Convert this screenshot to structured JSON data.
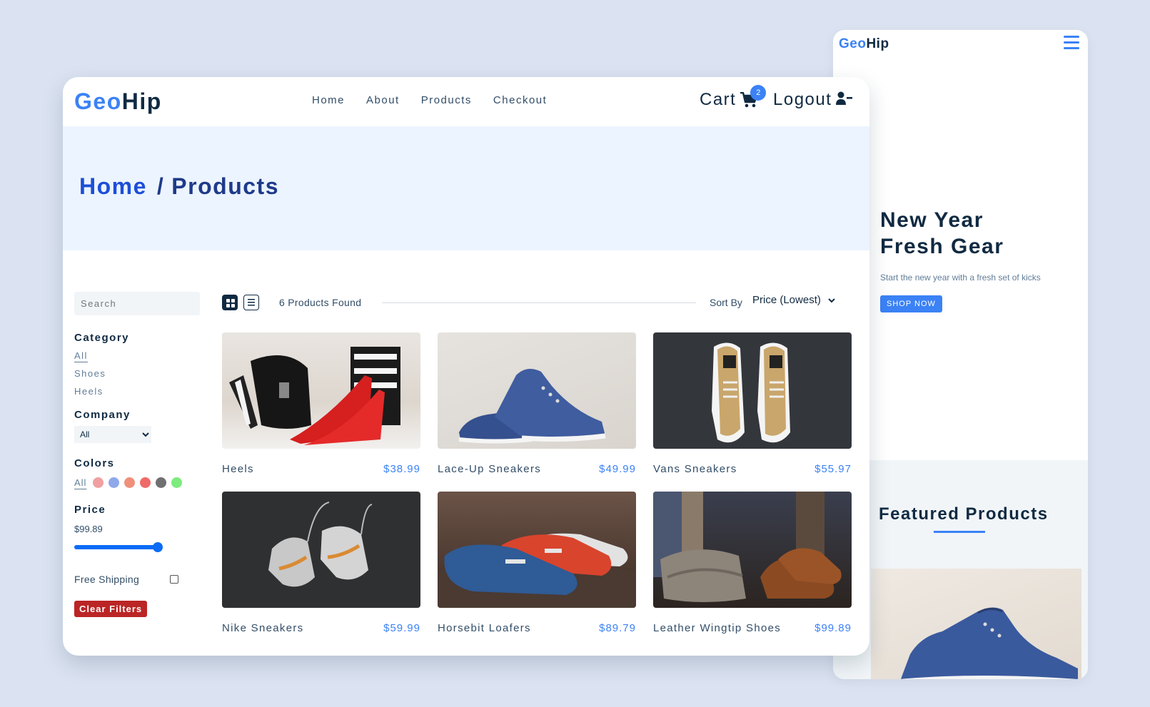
{
  "colors": {
    "accent": "#3b82f6",
    "dark": "#102a42",
    "hero_bg": "#ecf4ff",
    "clear_button": "#bb2525"
  },
  "brand": {
    "geo": "Geo",
    "hip": "Hip"
  },
  "nav": {
    "links": [
      "Home",
      "About",
      "Products",
      "Checkout"
    ],
    "cart_label": "Cart",
    "cart_count": "2",
    "logout_label": "Logout",
    "cart_icon": "cart-icon",
    "user_icon": "user-minus-icon"
  },
  "breadcrumb": {
    "home": "Home",
    "separator": "/",
    "current": "Products"
  },
  "filters": {
    "search_placeholder": "Search",
    "category_title": "Category",
    "categories": [
      "All",
      "Shoes",
      "Heels"
    ],
    "company_title": "Company",
    "company_selected": "All",
    "colors_title": "Colors",
    "colors_all": "All",
    "swatches": [
      "#f0a0a0",
      "#8fa8ea",
      "#f0907a",
      "#f06a6a",
      "#707070",
      "#7deb7d"
    ],
    "price_title": "Price",
    "price_value": "$99.89",
    "price_slider_fraction": 1.0,
    "free_shipping_label": "Free Shipping",
    "free_shipping_checked": false,
    "clear_label": "Clear Filters"
  },
  "toolbar": {
    "grid_icon": "grid-view-icon",
    "list_icon": "list-view-icon",
    "found_text": "6 Products Found",
    "sort_label": "Sort By",
    "sort_value": "Price (Lowest)"
  },
  "products": [
    {
      "name": "Heels",
      "price": "$38.99"
    },
    {
      "name": "Lace-Up Sneakers",
      "price": "$49.99"
    },
    {
      "name": "Vans Sneakers",
      "price": "$55.97"
    },
    {
      "name": "Nike Sneakers",
      "price": "$59.99"
    },
    {
      "name": "Horsebit Loafers",
      "price": "$89.79"
    },
    {
      "name": "Leather Wingtip Shoes",
      "price": "$99.89"
    }
  ],
  "mobile": {
    "brand_geo": "Geo",
    "brand_hip": "Hip",
    "menu_icon": "hamburger-menu-icon",
    "hero_line1": "New Year",
    "hero_line2": "Fresh Gear",
    "hero_sub": "Start the new year with a fresh set of kicks",
    "shop_label": "SHOP NOW",
    "featured_title": "Featured Products"
  }
}
